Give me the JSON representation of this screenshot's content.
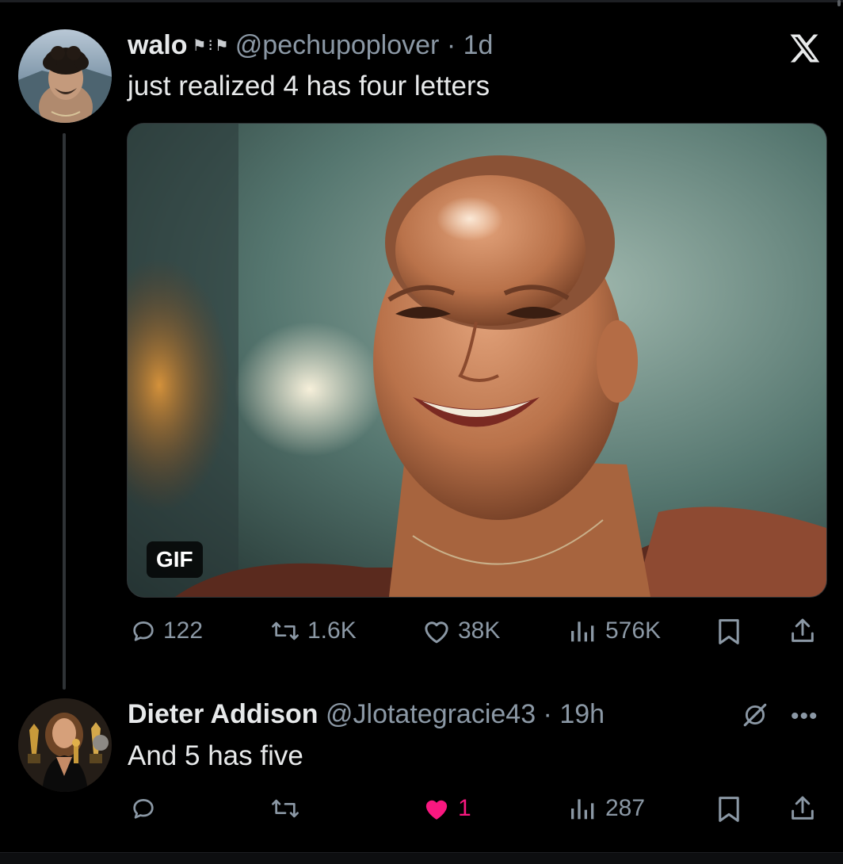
{
  "colors": {
    "background": "#000000",
    "text_primary": "#e7e9ea",
    "text_secondary": "#8b98a5",
    "like_active": "#f91880",
    "thread_line": "#2f3336"
  },
  "main_tweet": {
    "display_name": "walo",
    "name_decoration": "flag-emoji-pair",
    "handle_time": "@pechupoplover · 1d",
    "text": "just realized 4 has four letters",
    "media": {
      "type": "gif",
      "badge": "GIF",
      "description": "smiling-woman-shaved-head"
    },
    "platform_icon": "x-logo-icon",
    "actions": {
      "replies": "122",
      "reposts": "1.6K",
      "likes": "38K",
      "views": "576K",
      "bookmark_icon": "bookmark-icon",
      "share_icon": "share-icon"
    }
  },
  "reply_tweet": {
    "display_name": "Dieter Addison",
    "handle_time": "@Jlotategracie43 · 19h",
    "text": "And 5 has five",
    "extra_icon": "grok-slash-icon",
    "more_icon": "more-dots-icon",
    "actions": {
      "replies": "",
      "reposts": "",
      "likes": "1",
      "liked": true,
      "views": "287",
      "bookmark_icon": "bookmark-icon",
      "share_icon": "share-icon"
    }
  }
}
